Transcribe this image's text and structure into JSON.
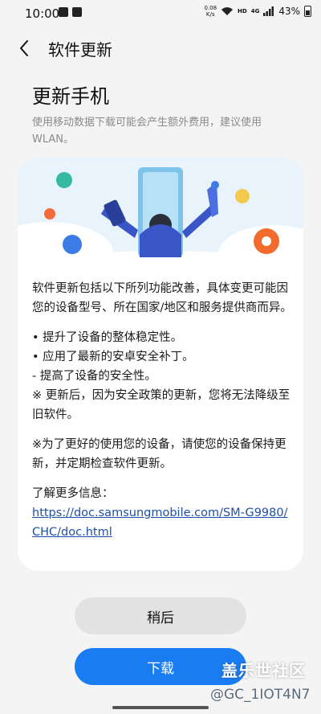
{
  "status_bar": {
    "time": "10:00",
    "net_speed_value": "0.08",
    "net_speed_unit": "K/s",
    "hd_label": "HD",
    "network_label": "4G",
    "battery": "43%"
  },
  "header": {
    "title": "软件更新"
  },
  "page": {
    "heading": "更新手机",
    "subtitle": "使用移动数据下载可能会产生额外费用，建议使用WLAN。"
  },
  "release_notes": {
    "intro": "软件更新包括以下所列功能改善，具体变更可能因您的设备型号、所在国家/地区和服务提供商而异。",
    "items": [
      "• 提升了设备的整体稳定性。",
      "• 应用了最新的安卓安全补丁。",
      " - 提高了设备的安全性。",
      "※ 更新后，因为安全政策的更新，您将无法降级至旧软件。"
    ],
    "note": "※为了更好的使用您的设备，请使您的设备保持更新，并定期检查软件更新。",
    "more_info_label": "了解更多信息：",
    "more_info_url": "https://doc.samsungmobile.com/SM-G9980/CHC/doc.html"
  },
  "buttons": {
    "later": "稍后",
    "download": "下载"
  },
  "watermark": {
    "line1": "盖乐世社区",
    "line2": "@GC_1IOT4N7"
  },
  "colors": {
    "accent": "#1a7cf3",
    "link": "#1e4fa8"
  }
}
